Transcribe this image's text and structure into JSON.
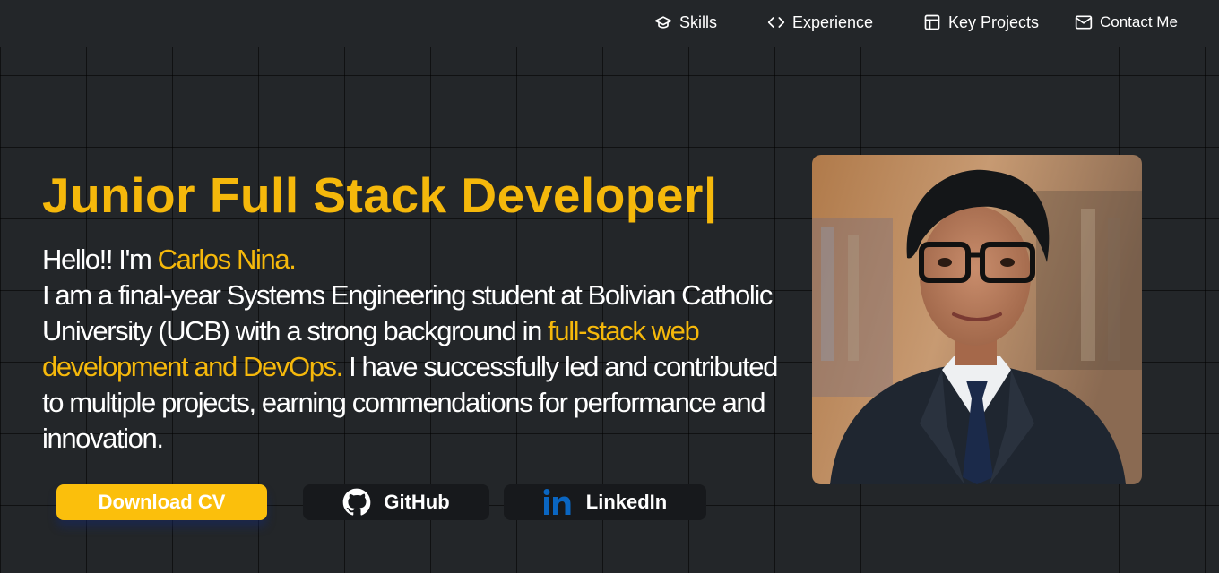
{
  "nav": {
    "items": [
      {
        "label": "Skills",
        "icon": "graduation-cap-icon"
      },
      {
        "label": "Experience",
        "icon": "code-icon"
      },
      {
        "label": "Key Projects",
        "icon": "layout-icon"
      },
      {
        "label": "Contact Me",
        "icon": "mail-icon"
      }
    ]
  },
  "hero": {
    "headline": "Junior Full Stack Developer|",
    "greeting": "Hello!! I'm ",
    "name": "Carlos Nina.",
    "bio_part1": "I am a final-year Systems Engineering student at Bolivian Catholic University (UCB) with a strong background in ",
    "bio_highlight": "full-stack web development and DevOps.",
    "bio_part2": " I have successfully led and contributed to multiple projects, earning commendations for performance and innovation."
  },
  "buttons": {
    "download_cv": "Download CV",
    "github": "GitHub",
    "linkedin": "LinkedIn"
  },
  "colors": {
    "accent": "#f5b80b",
    "background": "#232629",
    "button_dark": "#17191c",
    "linkedin": "#0a66c2"
  }
}
